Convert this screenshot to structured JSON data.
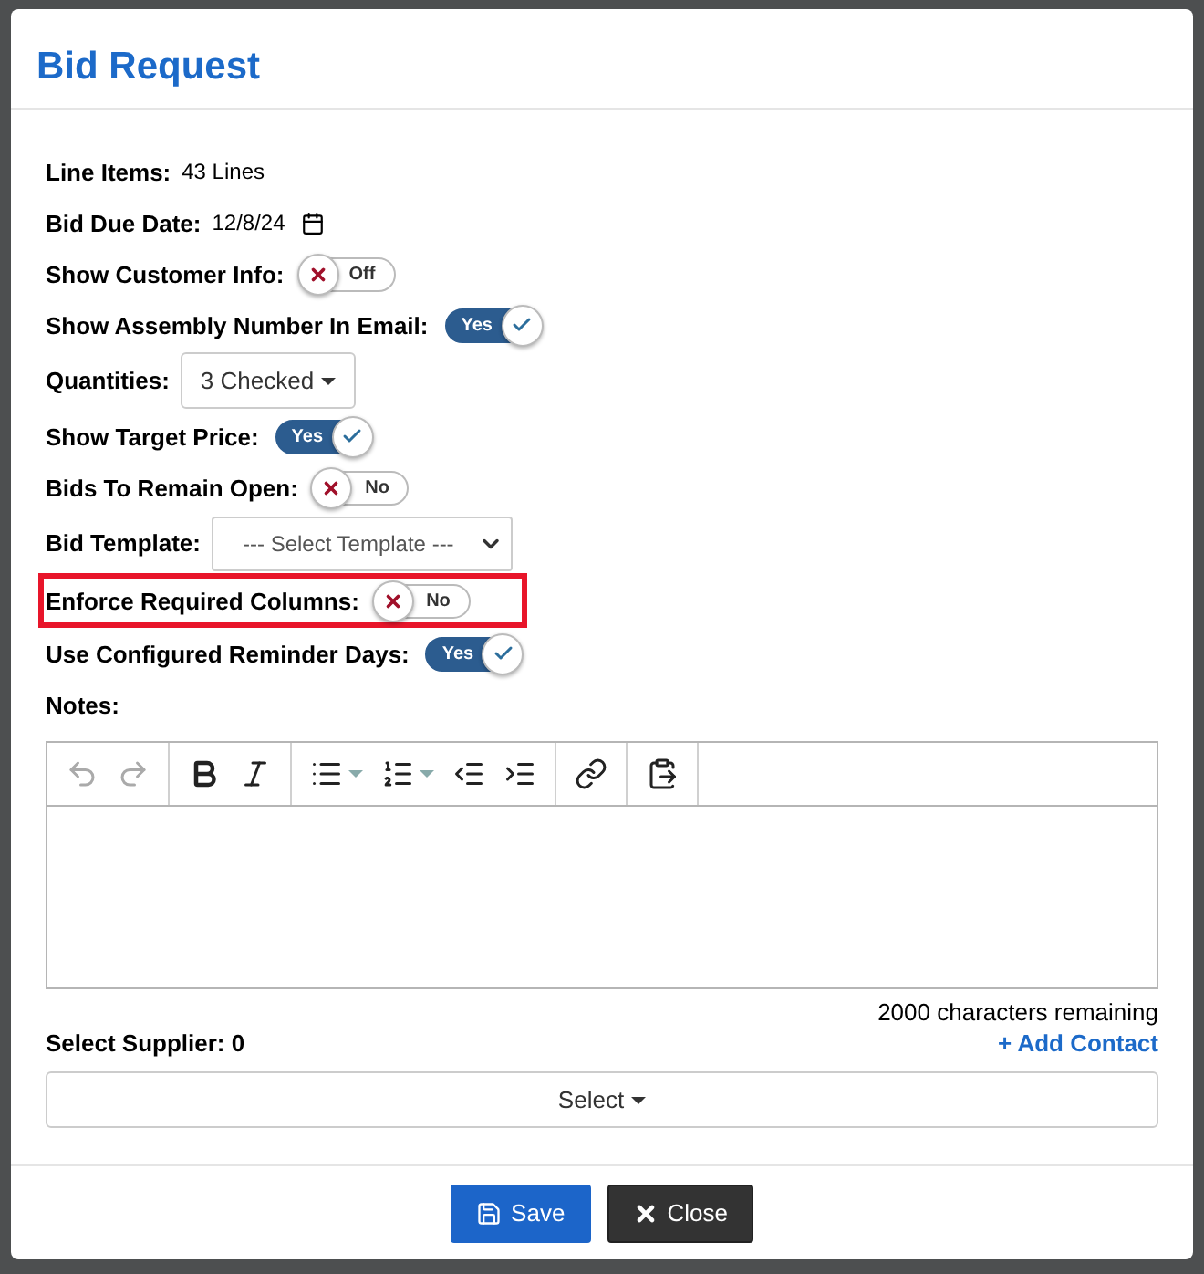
{
  "dialog": {
    "title": "Bid Request"
  },
  "fields": [
    {
      "kind": "text",
      "label": "Line Items:",
      "value": "43 Lines"
    },
    {
      "kind": "date",
      "label": "Bid Due Date:",
      "value": "12/8/24"
    },
    {
      "kind": "toggle",
      "label": "Show Customer Info:",
      "on": false,
      "state_text": "Off"
    },
    {
      "kind": "toggle",
      "label": "Show Assembly Number In Email:",
      "on": true,
      "state_text": "Yes"
    },
    {
      "kind": "dropdown",
      "label": "Quantities:",
      "value": "3 Checked"
    },
    {
      "kind": "toggle",
      "label": "Show Target Price:",
      "on": true,
      "state_text": "Yes"
    },
    {
      "kind": "toggle",
      "label": "Bids To Remain Open:",
      "on": false,
      "state_text": "No"
    },
    {
      "kind": "select",
      "label": "Bid Template:",
      "value": "--- Select Template ---"
    },
    {
      "kind": "toggle",
      "label": "Enforce Required Columns:",
      "on": false,
      "state_text": "No",
      "highlighted": true
    },
    {
      "kind": "toggle",
      "label": "Use Configured Reminder Days:",
      "on": true,
      "state_text": "Yes"
    }
  ],
  "notes": {
    "label": "Notes:",
    "toolbar": [
      {
        "tools": [
          {
            "kind": "undo",
            "disabled": true
          },
          {
            "kind": "redo",
            "disabled": true
          }
        ]
      },
      {
        "tools": [
          {
            "kind": "bold",
            "disabled": false
          },
          {
            "kind": "italic",
            "disabled": false
          }
        ]
      },
      {
        "tools": [
          {
            "kind": "bullets",
            "disabled": false
          },
          {
            "kind": "numbers",
            "disabled": false
          },
          {
            "kind": "outdent",
            "disabled": false
          },
          {
            "kind": "indent",
            "disabled": false
          }
        ]
      },
      {
        "tools": [
          {
            "kind": "link",
            "disabled": false
          }
        ]
      },
      {
        "tools": [
          {
            "kind": "paste",
            "disabled": false
          }
        ]
      }
    ],
    "remaining": "2000 characters remaining"
  },
  "supplier": {
    "label": "Select Supplier: 0",
    "add_link": "+ Add Contact",
    "select": "Select"
  },
  "buttons": [
    {
      "kind": "save",
      "label": "Save"
    },
    {
      "kind": "close",
      "label": "Close"
    }
  ]
}
